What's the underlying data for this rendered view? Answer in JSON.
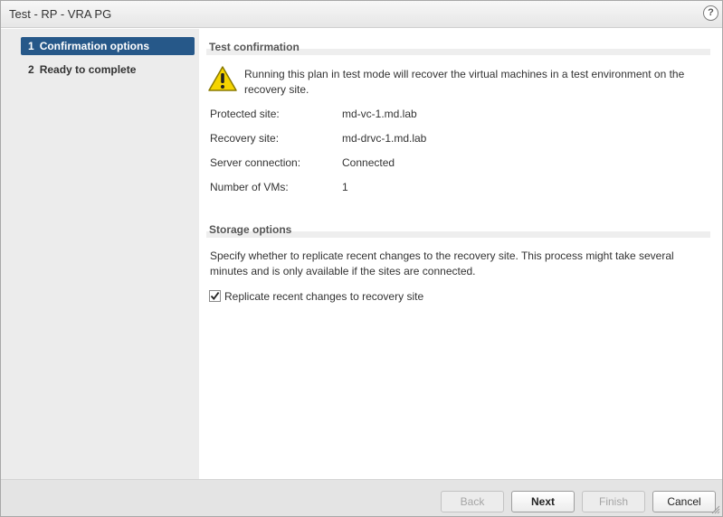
{
  "window": {
    "title": "Test - RP - VRA PG",
    "help_icon": "help-icon"
  },
  "sidebar": {
    "steps": [
      {
        "number": "1",
        "label": "Confirmation options",
        "active": true
      },
      {
        "number": "2",
        "label": "Ready to complete",
        "active": false
      }
    ]
  },
  "test_confirmation": {
    "heading": "Test confirmation",
    "warning_icon": "warning-icon",
    "warning_text": "Running this plan in test mode will recover the virtual machines in a test environment on the recovery site.",
    "fields": [
      {
        "label": "Protected site:",
        "value": "md-vc-1.md.lab"
      },
      {
        "label": "Recovery site:",
        "value": "md-drvc-1.md.lab"
      },
      {
        "label": "Server connection:",
        "value": "Connected"
      },
      {
        "label": "Number of VMs:",
        "value": "1"
      }
    ]
  },
  "storage_options": {
    "heading": "Storage options",
    "description": "Specify whether to replicate recent changes to the recovery site. This process might take several minutes and is only available if the sites are connected.",
    "checkbox_label": "Replicate recent changes to recovery site",
    "checked": true
  },
  "footer": {
    "back_label": "Back",
    "next_label": "Next",
    "finish_label": "Finish",
    "cancel_label": "Cancel"
  },
  "colors": {
    "active_step": "#265889",
    "sidebar_bg": "#ececec",
    "warning_yellow": "#f5d400"
  }
}
